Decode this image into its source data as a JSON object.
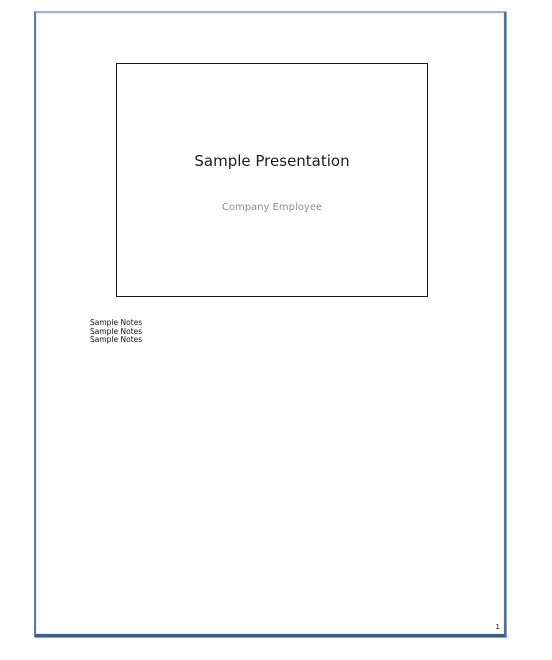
{
  "slide": {
    "title": "Sample Presentation",
    "subtitle": "Company Employee"
  },
  "notes": [
    "Sample Notes",
    "Sample Notes",
    "Sample Notes"
  ],
  "page": {
    "number": "1"
  },
  "colors": {
    "page_border": "#4f6f97",
    "slide_border": "#1a1a1a",
    "subtitle_text": "#8c8c8c"
  }
}
